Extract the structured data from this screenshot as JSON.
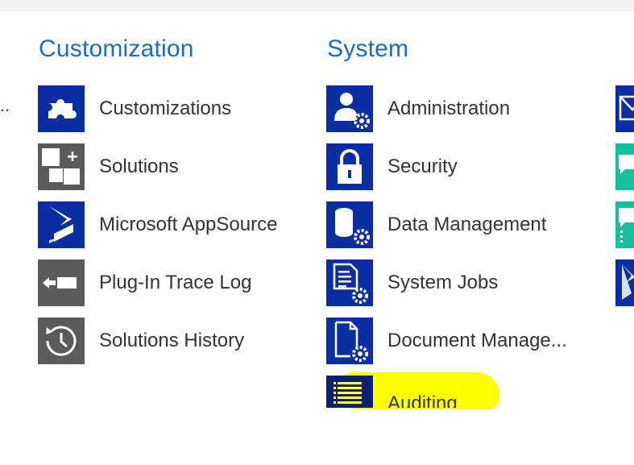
{
  "columns": {
    "customization": {
      "heading": "Customization",
      "items": [
        {
          "label": "Customizations",
          "icon": "puzzle-icon",
          "color": "#0a2fa2"
        },
        {
          "label": "Solutions",
          "icon": "solutions-icon",
          "color": "#5b5b5b"
        },
        {
          "label": "Microsoft AppSource",
          "icon": "dynamics-logo-icon",
          "color": "#0a2fa2"
        },
        {
          "label": "Plug-In Trace Log",
          "icon": "trace-log-icon",
          "color": "#5b5b5b"
        },
        {
          "label": "Solutions History",
          "icon": "history-icon",
          "color": "#5b5b5b"
        }
      ]
    },
    "system": {
      "heading": "System",
      "items": [
        {
          "label": "Administration",
          "icon": "administration-icon",
          "color": "#0a2fa2"
        },
        {
          "label": "Security",
          "icon": "lock-icon",
          "color": "#0a2fa2"
        },
        {
          "label": "Data Management",
          "icon": "data-management-icon",
          "color": "#0a2fa2"
        },
        {
          "label": "System Jobs",
          "icon": "system-jobs-icon",
          "color": "#0a2fa2"
        },
        {
          "label": "Document Manage...",
          "icon": "document-management-icon",
          "color": "#0a2fa2"
        },
        {
          "label": "Auditing",
          "icon": "auditing-icon",
          "color": "#0a2fa2"
        }
      ]
    }
  },
  "left_cutoff_text": "..",
  "highlight_color": "#ffff00",
  "accent_color": "#1e6bbd"
}
